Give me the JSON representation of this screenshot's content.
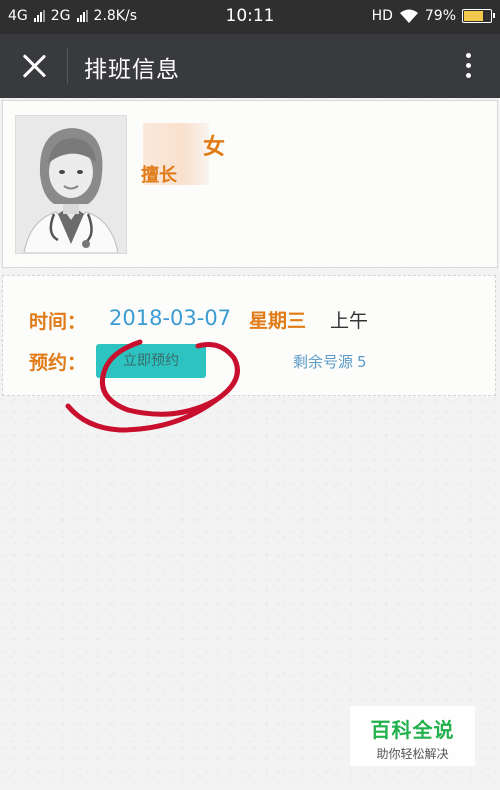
{
  "status_bar": {
    "network1": "4G",
    "network2": "2G",
    "speed": "2.8K/s",
    "time": "10:11",
    "hd": "HD",
    "battery_percent": "79%",
    "battery_level": 0.79
  },
  "header": {
    "title": "排班信息",
    "close_icon": "close-icon",
    "more_icon": "more-vertical-icon"
  },
  "doctor": {
    "name_suffix": "女",
    "title_prefix": "擅长",
    "avatar_icon": "doctor-avatar-icon"
  },
  "schedule": {
    "time_label": "时间：",
    "date": "2018-03-07",
    "weekday": "星期三",
    "period": "上午",
    "booking_label": "预约：",
    "book_button": "立即预约",
    "remaining_label": "剩余号源",
    "remaining_count": "5"
  },
  "watermark": {
    "title": "百科全说",
    "subtitle": "助你轻松解决"
  },
  "colors": {
    "accent_orange": "#e07b18",
    "date_blue": "#3b9bd3",
    "button_teal": "#2cc3c0",
    "annotation_red": "#c8102e"
  }
}
